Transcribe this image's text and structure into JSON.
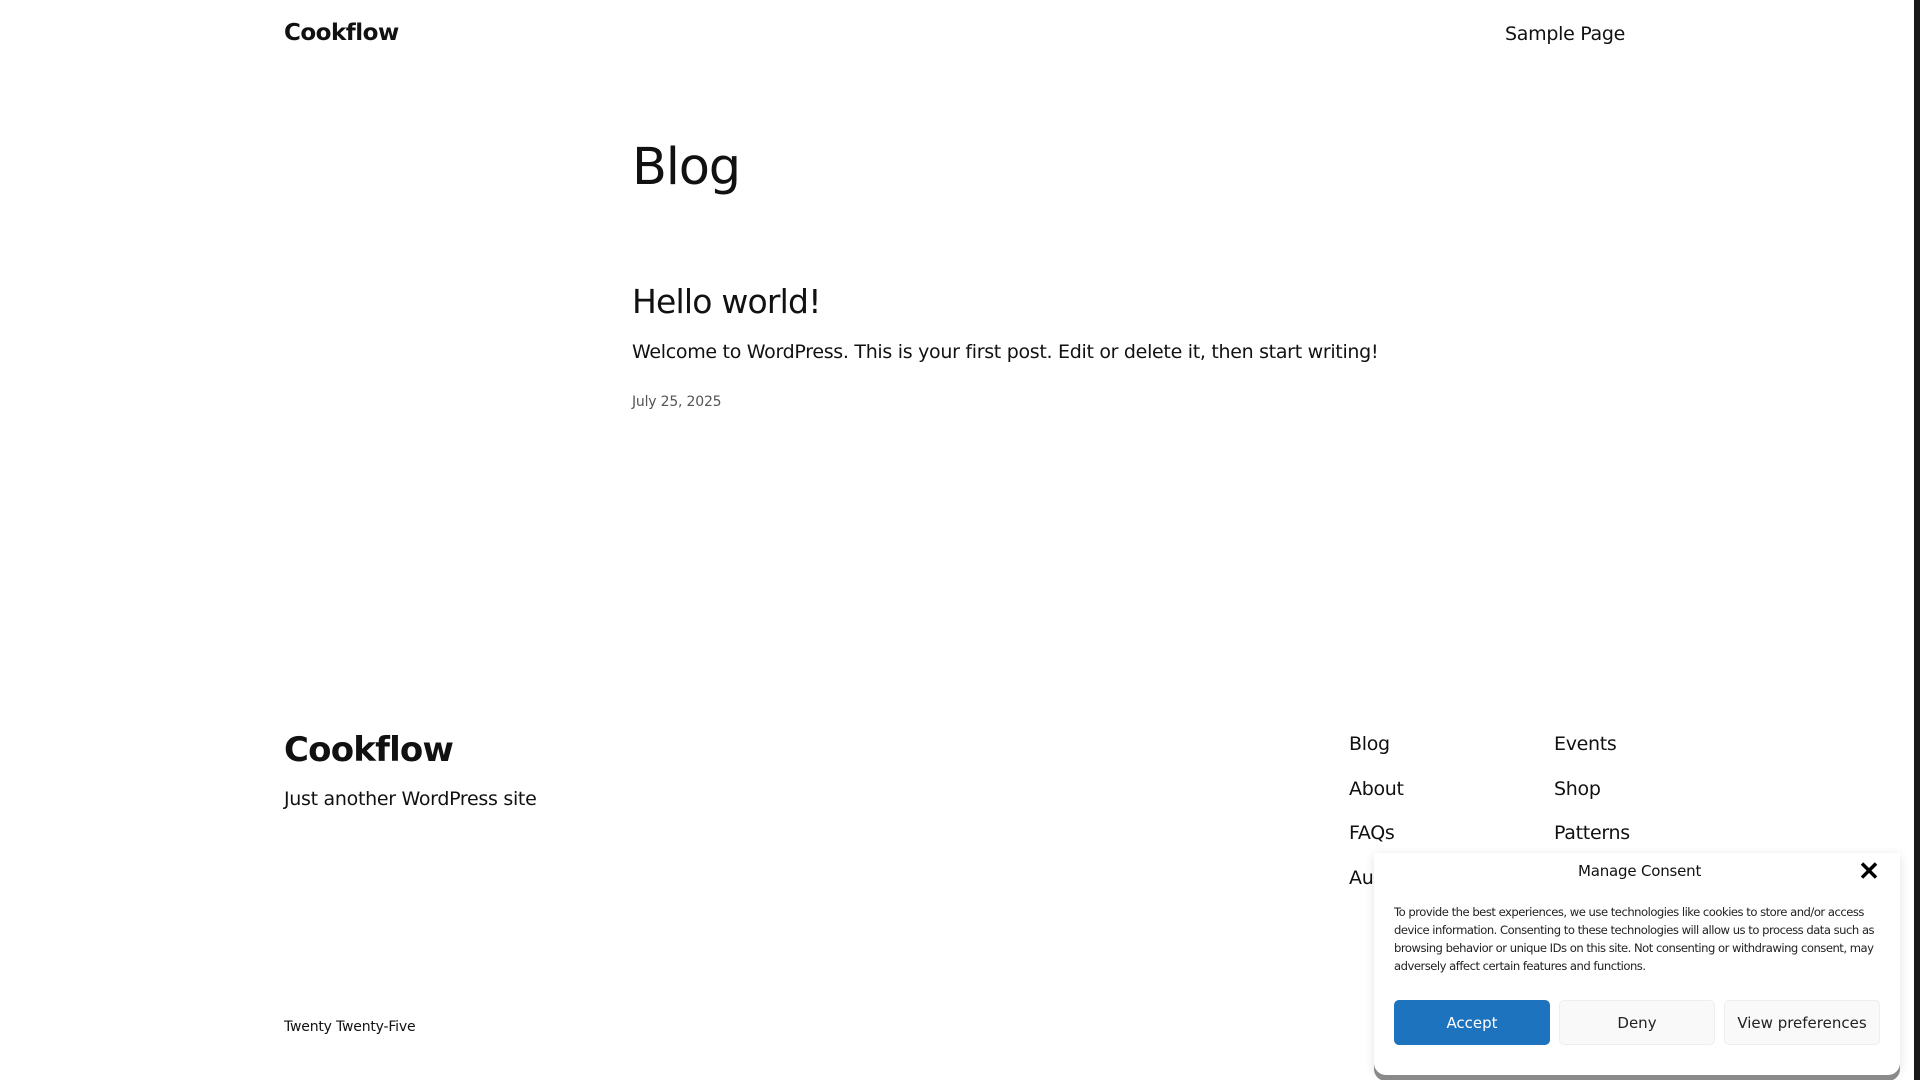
{
  "header": {
    "site_title": "Cookflow",
    "nav": [
      "Sample Page"
    ]
  },
  "main": {
    "heading": "Blog",
    "posts": [
      {
        "title": "Hello world!",
        "excerpt": "Welcome to WordPress. This is your first post. Edit or delete it, then start writing!",
        "date": "July 25, 2025"
      }
    ]
  },
  "footer": {
    "site_title": "Cookflow",
    "tagline": "Just another WordPress site",
    "nav_col_1": [
      "Blog",
      "About",
      "FAQs",
      "Au"
    ],
    "nav_col_2": [
      "Events",
      "Shop",
      "Patterns"
    ],
    "credit": "Twenty Twenty-Five"
  },
  "consent": {
    "title": "Manage Consent",
    "close_icon": "close-icon",
    "text": "To provide the best experiences, we use technologies like cookies to store and/or access device information. Consenting to these technologies will allow us to process data such as browsing behavior or unique IDs on this site. Not consenting or withdrawing consent, may adversely affect certain features and functions.",
    "accept_label": "Accept",
    "deny_label": "Deny",
    "preferences_label": "View preferences",
    "accent_color": "#1e73be"
  }
}
